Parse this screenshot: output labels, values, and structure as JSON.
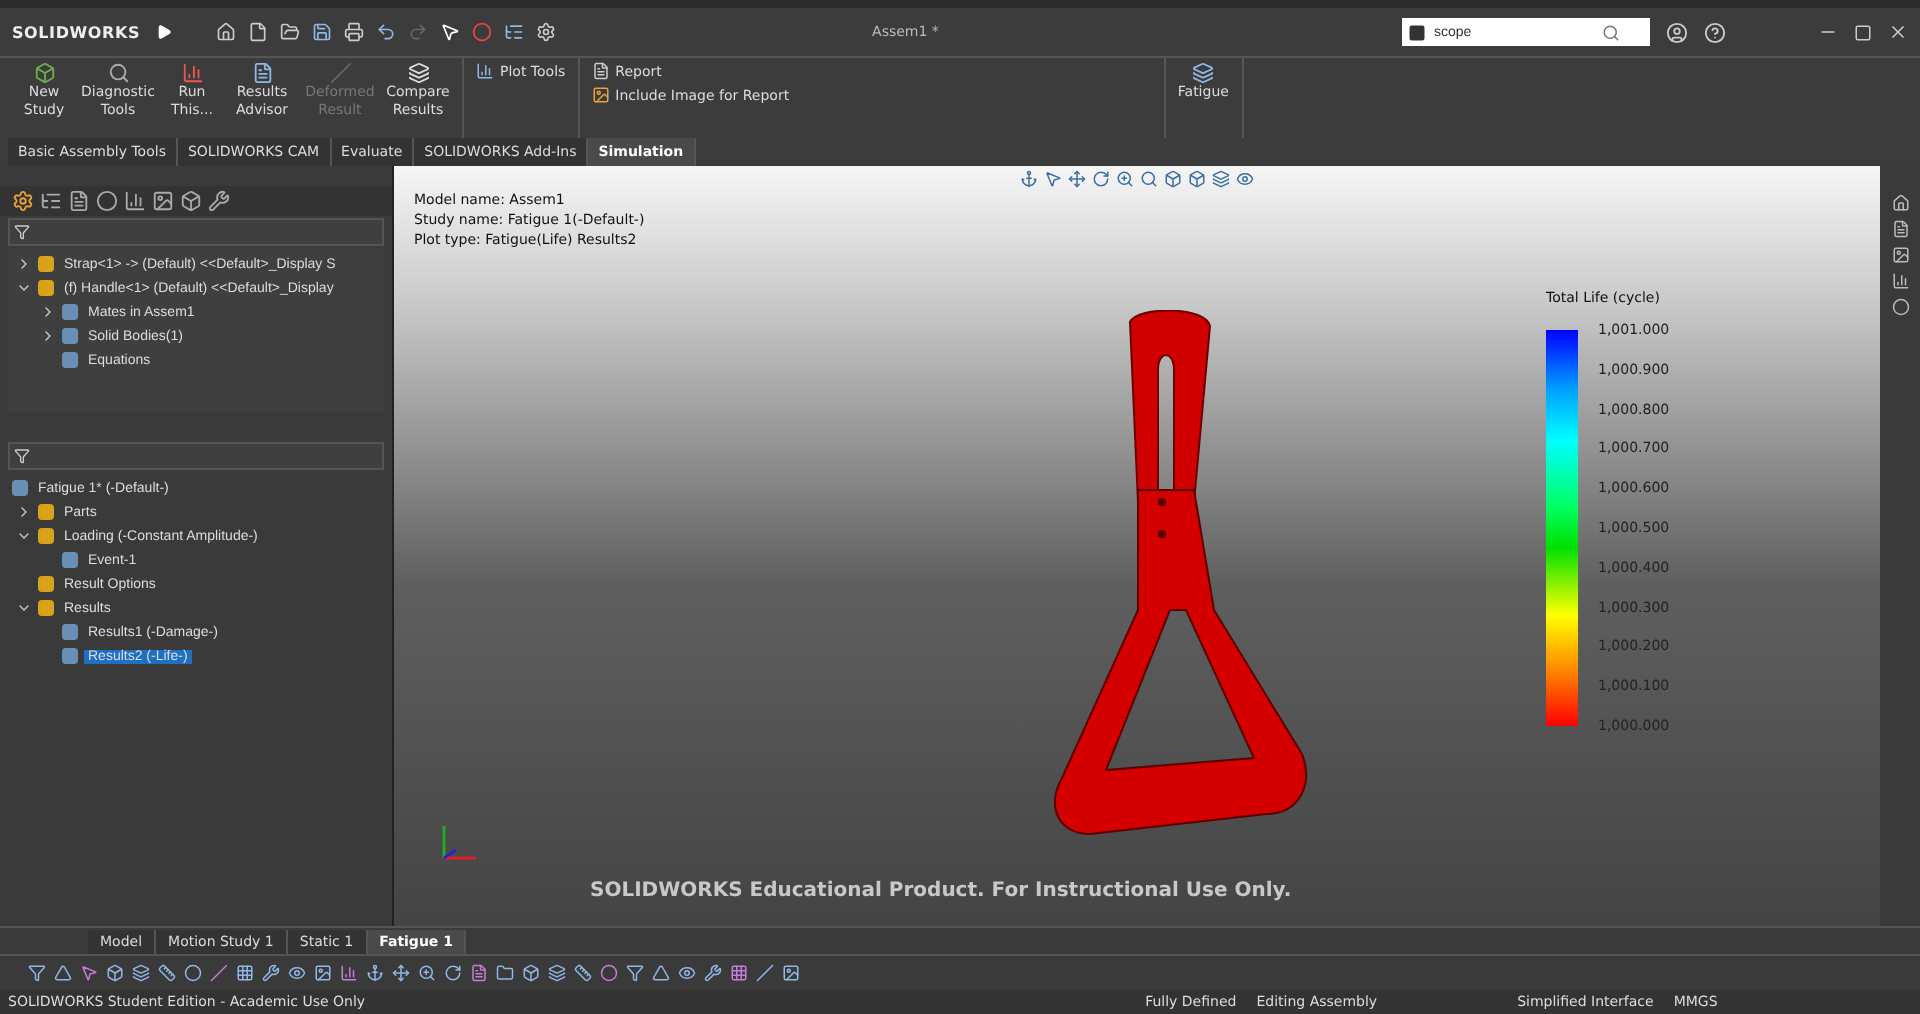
{
  "title_bar": {
    "app_name": "SOLIDWORKS",
    "document_title": "Assem1 *",
    "search": {
      "value": "scope"
    }
  },
  "ribbon": {
    "buttons": [
      {
        "label": "New Study",
        "disabled": false
      },
      {
        "label": "Diagnostic Tools",
        "disabled": false
      },
      {
        "label": "Run This...",
        "disabled": false
      },
      {
        "label": "Results Advisor",
        "disabled": false
      },
      {
        "label": "Deformed Result",
        "disabled": true
      },
      {
        "label": "Compare Results",
        "disabled": false
      }
    ],
    "plot_tools": "Plot Tools",
    "report": "Report",
    "include_image": "Include Image for Report",
    "fatigue": "Fatigue"
  },
  "command_tabs": [
    {
      "label": "Basic Assembly Tools",
      "selected": false
    },
    {
      "label": "SOLIDWORKS CAM",
      "selected": false
    },
    {
      "label": "Evaluate",
      "selected": false
    },
    {
      "label": "SOLIDWORKS Add-Ins",
      "selected": false
    },
    {
      "label": "Simulation",
      "selected": true
    }
  ],
  "feature_tree": {
    "items": [
      {
        "label": "Strap<1> -> (Default) <<Default>_Display S",
        "expanded": false,
        "selected": false
      },
      {
        "label": "(f) Handle<1> (Default) <<Default>_Display",
        "expanded": true,
        "selected": false,
        "children": [
          {
            "label": "Mates in Assem1",
            "expanded": false,
            "selected": false
          },
          {
            "label": "Solid Bodies(1)",
            "expanded": false,
            "selected": false
          },
          {
            "label": "Equations",
            "selected": false
          }
        ]
      }
    ]
  },
  "study_tree": {
    "root": "Fatigue 1* (-Default-)",
    "items": [
      {
        "label": "Parts",
        "expanded": false,
        "selected": false
      },
      {
        "label": "Loading (-Constant Amplitude-)",
        "expanded": true,
        "selected": false,
        "children": [
          {
            "label": "Event-1",
            "selected": false
          }
        ]
      },
      {
        "label": "Result Options",
        "selected": false
      },
      {
        "label": "Results",
        "expanded": true,
        "selected": false,
        "children": [
          {
            "label": "Results1 (-Damage-)",
            "selected": false
          },
          {
            "label": "Results2 (-Life-)",
            "selected": true
          }
        ]
      }
    ]
  },
  "viewport": {
    "info": [
      "Model name: Assem1",
      "Study name: Fatigue 1(-Default-)",
      "Plot type: Fatigue(Life) Results2"
    ],
    "legend": {
      "title": "Total Life (cycle)",
      "labels": [
        "1,001.000",
        "1,000.900",
        "1,000.800",
        "1,000.700",
        "1,000.600",
        "1,000.500",
        "1,000.400",
        "1,000.300",
        "1,000.200",
        "1,000.100",
        "1,000.000"
      ]
    },
    "notice": "SOLIDWORKS Educational Product. For Instructional Use Only."
  },
  "bottom_tabs": [
    {
      "label": "Model",
      "selected": false
    },
    {
      "label": "Motion Study 1",
      "selected": false
    },
    {
      "label": "Static 1",
      "selected": false
    },
    {
      "label": "Fatigue 1",
      "selected": true
    }
  ],
  "status_bar": {
    "edition": "SOLIDWORKS Student Edition - Academic Use Only",
    "items": [
      "Fully Defined",
      "Editing Assembly",
      "Simplified Interface",
      "MMGS"
    ]
  }
}
